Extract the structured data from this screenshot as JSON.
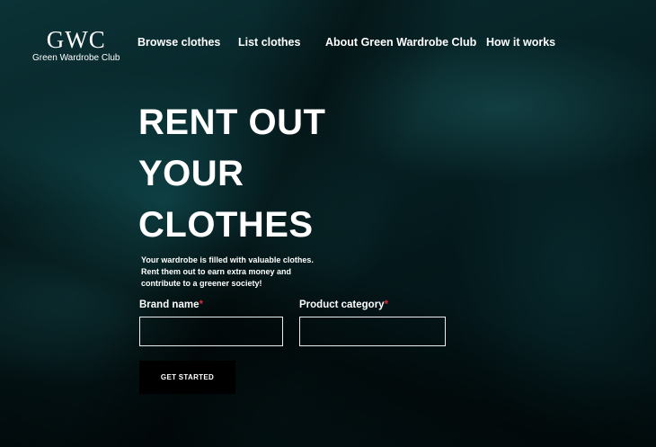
{
  "logo": {
    "mark": "GWC",
    "subtitle": "Green Wardrobe Club"
  },
  "nav": {
    "browse": "Browse clothes",
    "list": "List clothes",
    "about": "About Green Wardrobe Club",
    "how": "How it works"
  },
  "hero": {
    "title_lines": [
      "RENT OUT",
      "YOUR",
      "CLOTHES"
    ],
    "description_lines": [
      "Your wardrobe is filled with valuable clothes.",
      "Rent them out to earn extra money and",
      "contribute to a greener society!"
    ]
  },
  "form": {
    "brand_label": "Brand name",
    "category_label": "Product category",
    "required_mark": "*",
    "brand_value": "",
    "category_value": "",
    "submit_label": "GET STARTED"
  },
  "colors": {
    "required": "#d92b3a",
    "button_bg": "#000000",
    "background": "#072326"
  }
}
